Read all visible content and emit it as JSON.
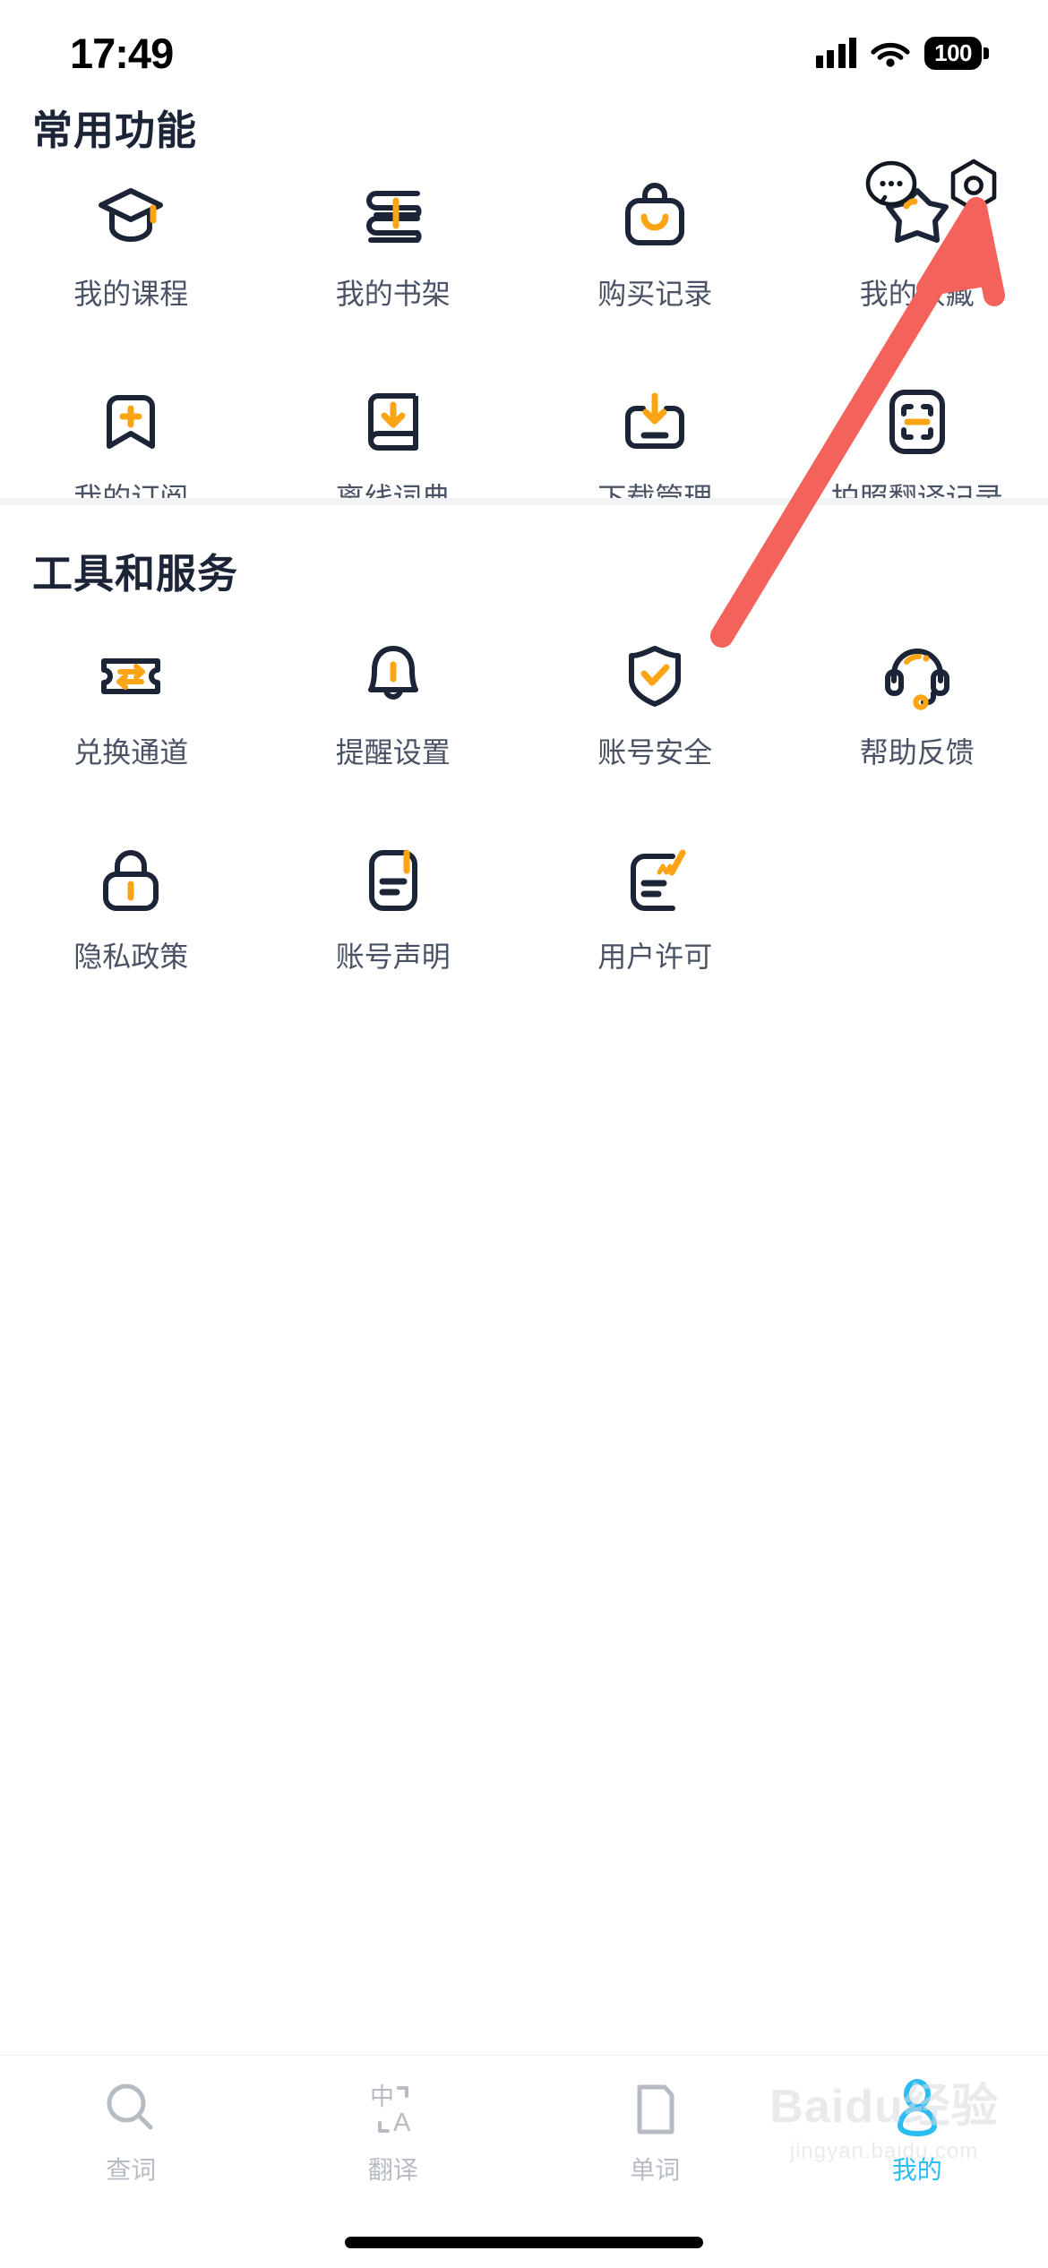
{
  "status_bar": {
    "time": "17:49",
    "battery_level": "100",
    "signal_icon": "cellular-bars-icon",
    "wifi_icon": "wifi-icon",
    "battery_icon": "battery-full-icon"
  },
  "top_actions": [
    {
      "name": "message-bubble-icon",
      "label": "消息"
    },
    {
      "name": "settings-gear-icon",
      "label": "设置"
    }
  ],
  "sections": [
    {
      "id": "common",
      "title": "常用功能",
      "items": [
        {
          "label": "我的课程",
          "icon": "graduation-cap-icon"
        },
        {
          "label": "我的书架",
          "icon": "books-stack-icon"
        },
        {
          "label": "购买记录",
          "icon": "shopping-bag-icon"
        },
        {
          "label": "我的收藏",
          "icon": "star-icon"
        },
        {
          "label": "我的订阅",
          "icon": "bookmark-plus-icon"
        },
        {
          "label": "离线词典",
          "icon": "book-download-icon"
        },
        {
          "label": "下载管理",
          "icon": "download-box-icon"
        },
        {
          "label": "拍照翻译记录",
          "icon": "scan-frame-icon"
        }
      ]
    },
    {
      "id": "tools",
      "title": "工具和服务",
      "items": [
        {
          "label": "兑换通道",
          "icon": "ticket-exchange-icon"
        },
        {
          "label": "提醒设置",
          "icon": "bell-icon"
        },
        {
          "label": "账号安全",
          "icon": "shield-check-icon"
        },
        {
          "label": "帮助反馈",
          "icon": "headset-icon"
        },
        {
          "label": "隐私政策",
          "icon": "lock-icon"
        },
        {
          "label": "账号声明",
          "icon": "document-lines-icon"
        },
        {
          "label": "用户许可",
          "icon": "document-pen-icon"
        }
      ]
    }
  ],
  "tabbar": {
    "active_index": 3,
    "tabs": [
      {
        "label": "查词",
        "icon": "search-icon"
      },
      {
        "label": "翻译",
        "icon": "translate-icon"
      },
      {
        "label": "单词",
        "icon": "word-card-icon"
      },
      {
        "label": "我的",
        "icon": "person-icon"
      }
    ]
  },
  "annotation": {
    "type": "arrow",
    "color": "#F4625C",
    "points_to": "settings-gear-icon"
  },
  "watermark": {
    "main": "Baidu经验",
    "sub": "jingyan.baidu.com"
  },
  "colors": {
    "icon_dark": "#1c2437",
    "icon_accent": "#FBA414",
    "label": "#4a5366",
    "tab_active": "#2BBCF4",
    "tab_inactive": "#b7bcc4",
    "divider": "#f2f3f5",
    "annotation": "#F4625C"
  }
}
